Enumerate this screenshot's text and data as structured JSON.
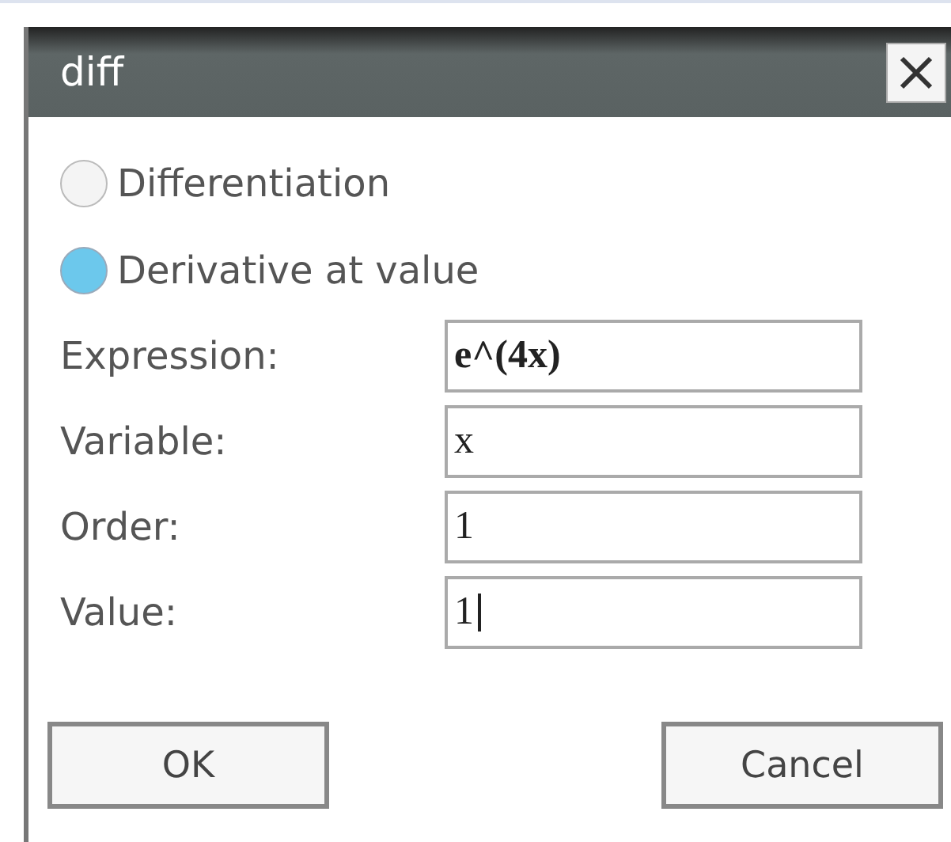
{
  "window": {
    "title": "diff"
  },
  "modes": [
    {
      "label": "Differentiation",
      "selected": false
    },
    {
      "label": "Derivative at value",
      "selected": true
    }
  ],
  "fields": [
    {
      "label": "Expression:",
      "value": "e^(4x)",
      "focused": false
    },
    {
      "label": "Variable:",
      "value": "x",
      "focused": false
    },
    {
      "label": "Order:",
      "value": "1",
      "focused": false
    },
    {
      "label": "Value:",
      "value": "1",
      "focused": true
    }
  ],
  "buttons": [
    "OK",
    "Cancel"
  ]
}
